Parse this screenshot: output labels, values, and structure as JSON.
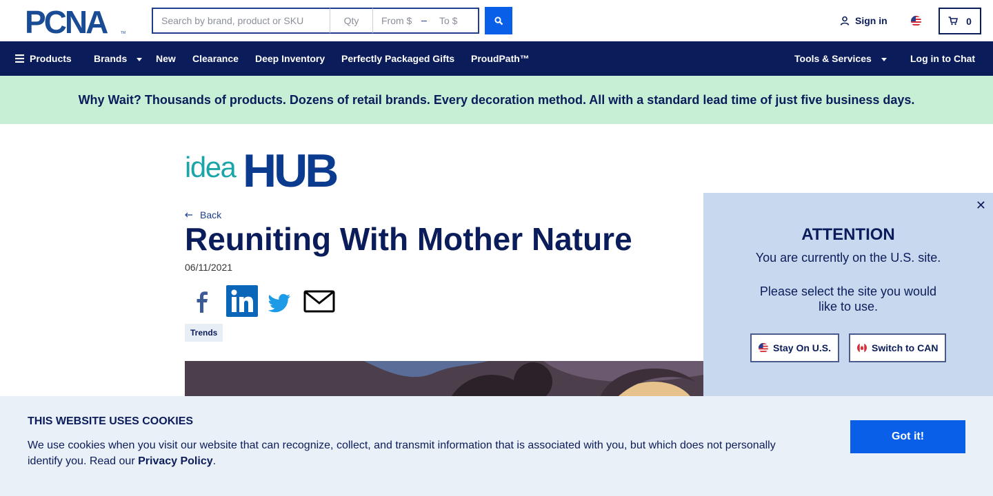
{
  "header": {
    "logo_text": "PCNA",
    "search": {
      "placeholder": "Search by brand, product or SKU",
      "value": ""
    },
    "qty": {
      "placeholder": "Qty"
    },
    "price_from": {
      "placeholder": "From $"
    },
    "price_to": {
      "placeholder": "To $"
    },
    "signin_label": "Sign in",
    "cart_count": "0"
  },
  "nav": {
    "items": [
      {
        "label": "Products"
      },
      {
        "label": "Brands"
      },
      {
        "label": "New"
      },
      {
        "label": "Clearance"
      },
      {
        "label": "Deep Inventory"
      },
      {
        "label": "Perfectly Packaged Gifts"
      },
      {
        "label": "ProudPath™"
      }
    ],
    "tools_label": "Tools & Services",
    "chat_label": "Log in to Chat"
  },
  "promo_text": "Why Wait? Thousands of products. Dozens of retail brands. Every decoration method. All with a standard lead time of just five business days.",
  "article": {
    "brand_text": {
      "idea": "idea",
      "hub": "HUB"
    },
    "back_label": "Back",
    "title": "Reuniting With Mother Nature",
    "date": "06/11/2021",
    "tag": "Trends"
  },
  "attention": {
    "title": "ATTENTION",
    "line1": "You are currently on the U.S. site.",
    "line2": "Please select the site you would like to use.",
    "stay_label": "Stay On U.S.",
    "switch_label": "Switch to CAN"
  },
  "cookies": {
    "heading": "THIS WEBSITE USES COOKIES",
    "body": "We use cookies when you visit our website that can recognize, collect, and transmit information that is associated with you, but which does not personally identify you. Read our ",
    "policy_link": "Privacy Policy",
    "end": ".",
    "button": "Got it!"
  },
  "colors": {
    "navy": "#0b1c5a",
    "blue": "#0a5fe8",
    "promo_bg": "#c6efd5",
    "attention_bg": "#c8d8ef",
    "cookie_bg": "#eaf0f8",
    "teal": "#1aa5a8"
  }
}
